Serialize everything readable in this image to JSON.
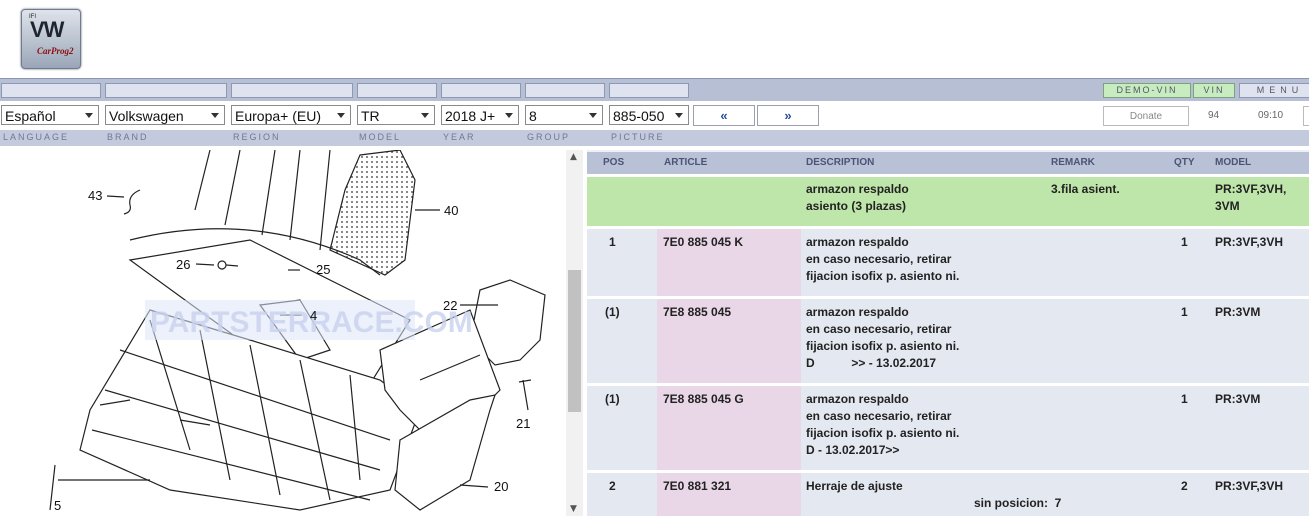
{
  "logo": {
    "top_text": "IFI",
    "main": "VW",
    "sub": "CarProg2"
  },
  "topbar": {
    "demo_vin": "DEMO-VIN",
    "vin": "VIN",
    "menu": "MENU"
  },
  "selectors": {
    "language": "Español",
    "brand": "Volkswagen",
    "region": "Europa+ (EU)",
    "model": "TR",
    "year": "2018  J+",
    "group": "8",
    "picture": "885-050",
    "prev": "«",
    "next": "»"
  },
  "status": {
    "donate": "Donate",
    "count": "94",
    "time": "09:10"
  },
  "labels": {
    "language": "LANGUAGE",
    "brand": "BRAND",
    "region": "REGION",
    "model": "MODEL",
    "year": "YEAR",
    "group": "GROUP",
    "picture": "PICTURE"
  },
  "drawing": {
    "callouts": [
      "43",
      "40",
      "26",
      "25",
      "4",
      "22",
      "21",
      "20",
      "5"
    ],
    "watermark": "PARTSTERRACE.COM"
  },
  "table": {
    "headers": {
      "pos": "POS",
      "article": "ARTICLE",
      "description": "DESCRIPTION",
      "remark": "REMARK",
      "qty": "QTY",
      "model": "MODEL"
    },
    "rows": [
      {
        "pos": "",
        "article": "",
        "desc": [
          "armazon respaldo",
          "asiento (3 plazas)"
        ],
        "remark": "3.fila asient.",
        "qty": "",
        "model": [
          "PR:3VF,3VH,",
          "3VM"
        ]
      },
      {
        "pos": "1",
        "article": "7E0 885 045 K",
        "desc": [
          "armazon respaldo",
          "en caso necesario, retirar",
          "fijacion isofix p. asiento ni."
        ],
        "remark": "",
        "qty": "1",
        "model": [
          "PR:3VF,3VH"
        ]
      },
      {
        "pos": "(1)",
        "article": "7E8 885 045",
        "desc": [
          "armazon respaldo",
          "en caso necesario, retirar",
          "fijacion isofix p. asiento ni.",
          "D           >> - 13.02.2017"
        ],
        "remark": "",
        "qty": "1",
        "model": [
          "PR:3VM"
        ]
      },
      {
        "pos": "(1)",
        "article": "7E8 885 045 G",
        "desc": [
          "armazon respaldo",
          "en caso necesario, retirar",
          "fijacion isofix p. asiento ni.",
          "D - 13.02.2017>>"
        ],
        "remark": "",
        "qty": "1",
        "model": [
          "PR:3VM"
        ]
      },
      {
        "pos": "2",
        "article": "7E0 881 321",
        "desc": [
          "Herraje de ajuste"
        ],
        "remark": "sin posicion:  7",
        "qty": "2",
        "model": [
          "PR:3VF,3VH"
        ]
      }
    ]
  }
}
